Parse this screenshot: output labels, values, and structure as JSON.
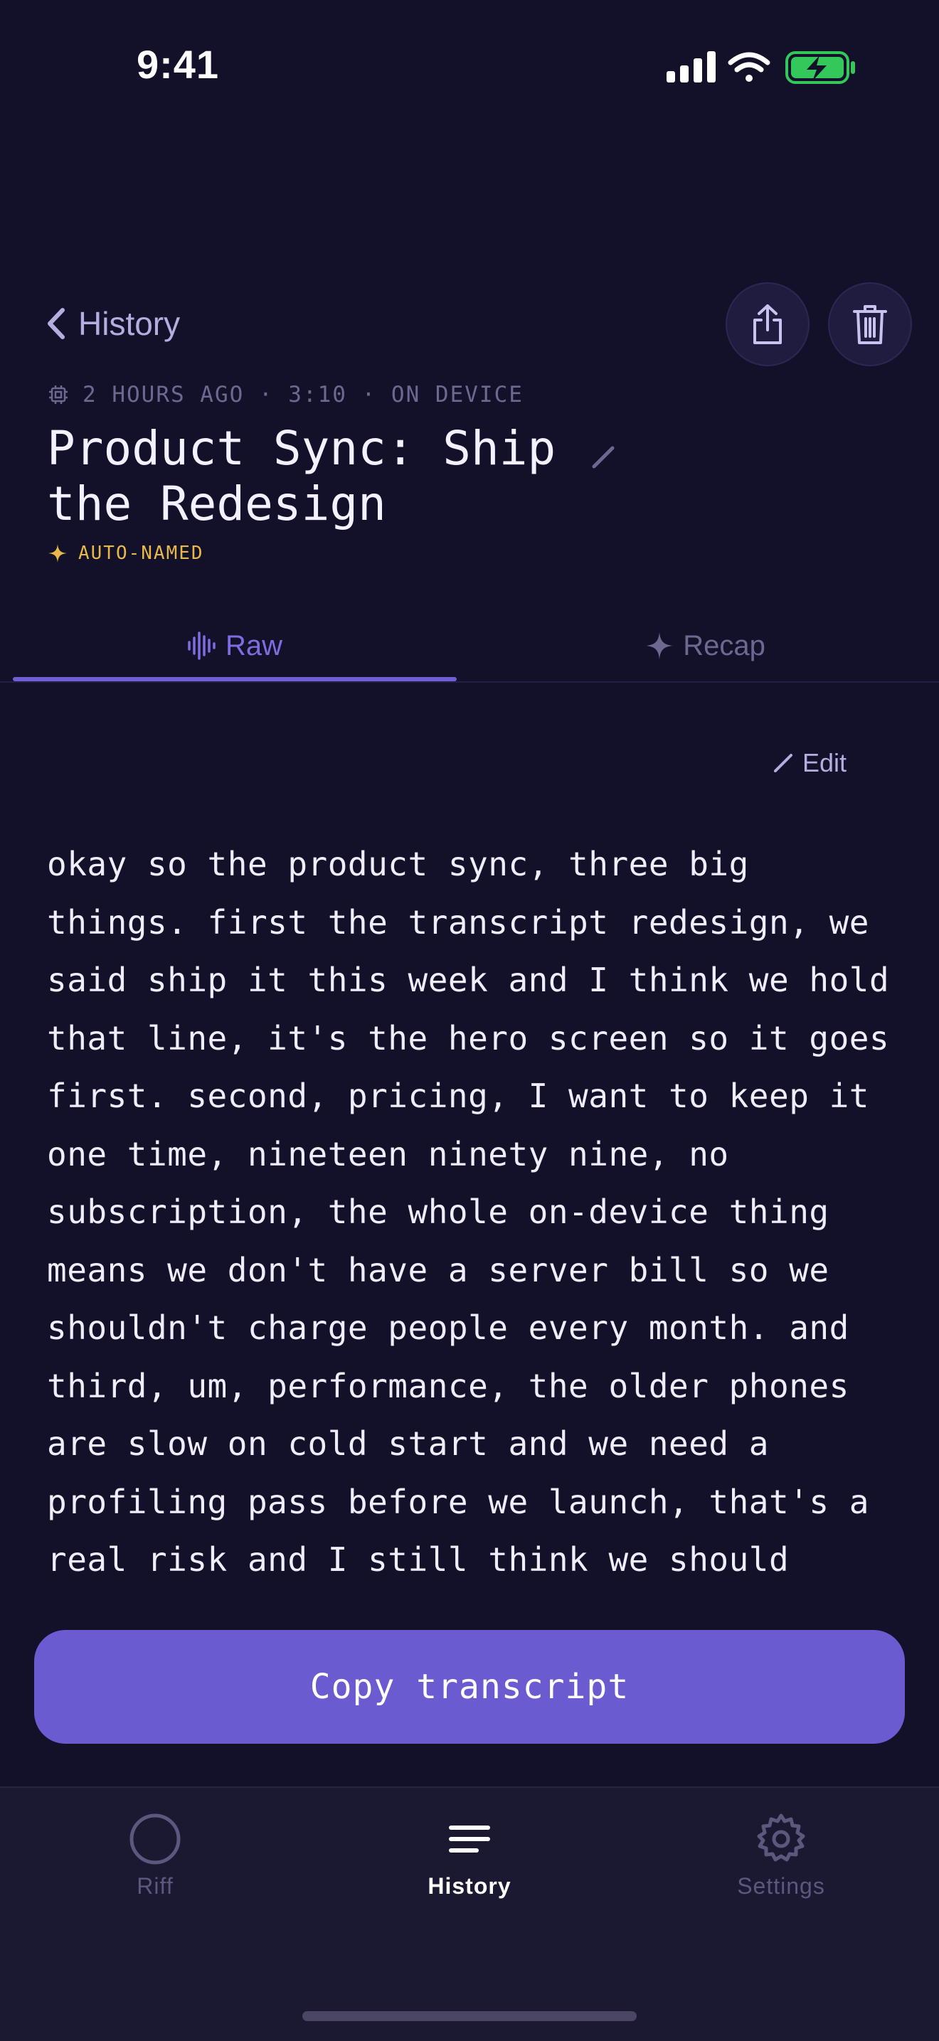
{
  "status_bar": {
    "time": "9:41"
  },
  "header": {
    "back_label": "History",
    "meta": "2 HOURS AGO · 3:10 · ON DEVICE",
    "title": "Product Sync: Ship the Redesign",
    "auto_named": "AUTO-NAMED"
  },
  "tabs": [
    {
      "label": "Raw",
      "selected": true
    },
    {
      "label": "Recap",
      "selected": false
    }
  ],
  "edit_label": "Edit",
  "transcript": "okay so the product sync, three big things. first the transcript redesign, we said ship it this week and I think we hold that line, it's the hero screen so it goes first. second, pricing, I want to keep it one time, nineteen ninety nine, no subscription, the whole on-device thing means we don't have a server bill so we shouldn't charge people every month. and third, um, performance, the older phones are slow on cold start and we need a profiling pass before we launch, that's a real risk and I still think we should",
  "copy_button": "Copy transcript",
  "tab_bar": {
    "items": [
      {
        "label": "Riff",
        "icon": "circle-icon",
        "selected": false
      },
      {
        "label": "History",
        "icon": "list-icon",
        "selected": true
      },
      {
        "label": "Settings",
        "icon": "gear-icon",
        "selected": false
      }
    ]
  },
  "colors": {
    "background": "#13102a",
    "accent": "#6b5bd0",
    "auto_named": "#e8b84a",
    "battery": "#34c759"
  }
}
